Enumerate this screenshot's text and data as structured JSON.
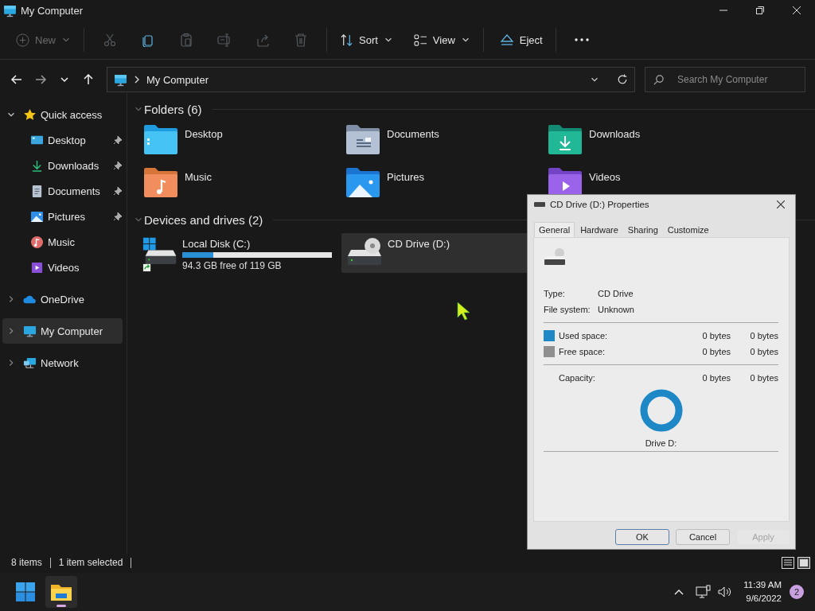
{
  "window": {
    "title": "My Computer"
  },
  "command_bar": {
    "new": {
      "label": "New",
      "disabled": true
    },
    "actions": [
      {
        "disabled": true
      },
      {
        "disabled": false
      },
      {
        "disabled": true
      },
      {
        "disabled": true
      },
      {
        "disabled": true
      },
      {
        "disabled": true
      }
    ],
    "sort": {
      "label": "Sort"
    },
    "view": {
      "label": "View"
    },
    "eject": {
      "label": "Eject"
    }
  },
  "navigation": [
    {
      "disabled": false
    },
    {
      "disabled": true
    },
    {
      "disabled": false
    },
    {
      "disabled": false
    }
  ],
  "address_bar": {
    "path": "My Computer"
  },
  "search": {
    "placeholder": "Search My Computer"
  },
  "sidebar": {
    "items": [
      {
        "label": "Quick access",
        "expanded": true,
        "selected": false,
        "children": [
          {
            "label": "Desktop",
            "pinned": true,
            "selected": false
          },
          {
            "label": "Downloads",
            "pinned": true,
            "selected": false
          },
          {
            "label": "Documents",
            "pinned": true,
            "selected": false
          },
          {
            "label": "Pictures",
            "pinned": true,
            "selected": false
          },
          {
            "label": "Music",
            "pinned": false,
            "selected": false
          },
          {
            "label": "Videos",
            "pinned": false,
            "selected": false
          }
        ]
      },
      {
        "label": "OneDrive",
        "expanded": false,
        "selected": false
      },
      {
        "label": "My Computer",
        "expanded": false,
        "selected": true
      },
      {
        "label": "Network",
        "expanded": false,
        "selected": false
      }
    ]
  },
  "folders": {
    "title": "Folders (6)",
    "expanded": true,
    "items": [
      {
        "name": "Desktop"
      },
      {
        "name": "Documents"
      },
      {
        "name": "Downloads"
      },
      {
        "name": "Music"
      },
      {
        "name": "Pictures"
      },
      {
        "name": "Videos"
      }
    ]
  },
  "drives": {
    "title": "Devices and drives (2)",
    "expanded": true,
    "items": [
      {
        "kind": "disk",
        "name": "Local Disk (C:)",
        "level": 0.21,
        "free": "94.3 GB free of 119 GB",
        "selected": false
      },
      {
        "kind": "optical",
        "name": "CD Drive (D:)",
        "selected": true
      }
    ]
  },
  "status_bar": {
    "items": [
      "8 items",
      "1 item selected"
    ]
  },
  "dialog": {
    "title": "CD Drive (D:) Properties",
    "tabs": [
      {
        "label": "General",
        "selected": true
      },
      {
        "label": "Hardware",
        "selected": false
      },
      {
        "label": "Sharing",
        "selected": false
      },
      {
        "label": "Customize",
        "selected": false
      }
    ],
    "info": [
      {
        "label": "Type:",
        "value": "CD Drive"
      },
      {
        "label": "File system:",
        "value": "Unknown"
      }
    ],
    "space": [
      {
        "label": "Used space:",
        "color": "#1e88c6",
        "bytes": "0 bytes",
        "size": "0 bytes"
      },
      {
        "label": "Free space:",
        "color": "#8f8f8f",
        "bytes": "0 bytes",
        "size": "0 bytes"
      }
    ],
    "capacity": {
      "label": "Capacity:",
      "bytes": "0 bytes",
      "size": "0 bytes"
    },
    "drive_label": "Drive D:",
    "buttons": [
      {
        "label": "OK",
        "default": true,
        "disabled": false
      },
      {
        "label": "Cancel",
        "default": false,
        "disabled": false
      },
      {
        "label": "Apply",
        "default": false,
        "disabled": true
      }
    ]
  },
  "taskbar": {
    "apps": [
      {
        "active": true
      }
    ],
    "time": "11:39 AM",
    "date": "9/6/2022",
    "notifications": "2"
  }
}
